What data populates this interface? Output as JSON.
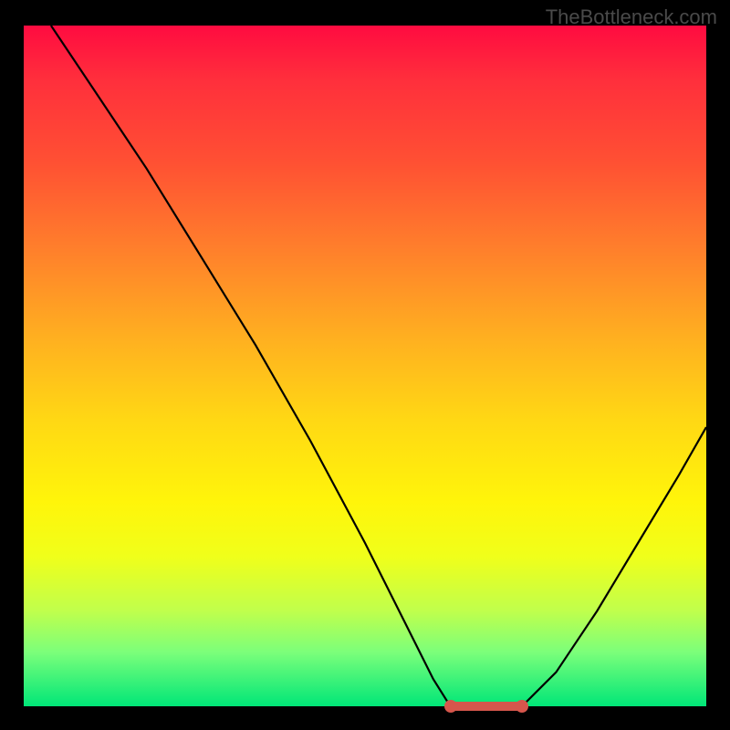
{
  "watermark": "TheBottleneck.com",
  "chart_data": {
    "type": "line",
    "title": "",
    "xlabel": "",
    "ylabel": "",
    "xlim": [
      0,
      100
    ],
    "ylim": [
      0,
      100
    ],
    "series": [
      {
        "name": "left-branch",
        "x": [
          4,
          10,
          18,
          26,
          34,
          42,
          50,
          56,
          60,
          62.5
        ],
        "y": [
          100,
          91,
          79,
          66,
          53,
          39,
          24,
          12,
          4,
          0
        ]
      },
      {
        "name": "trough",
        "x": [
          62.5,
          66,
          70,
          73
        ],
        "y": [
          0,
          0,
          0,
          0
        ]
      },
      {
        "name": "right-branch",
        "x": [
          73,
          78,
          84,
          90,
          96,
          100
        ],
        "y": [
          0,
          5,
          14,
          24,
          34,
          41
        ]
      }
    ],
    "markers": [
      {
        "x": 62.5,
        "y": 0
      },
      {
        "x": 73,
        "y": 0
      }
    ],
    "background_gradient": {
      "top": "#ff0b40",
      "mid": "#ffe710",
      "bottom": "#00e678"
    }
  }
}
